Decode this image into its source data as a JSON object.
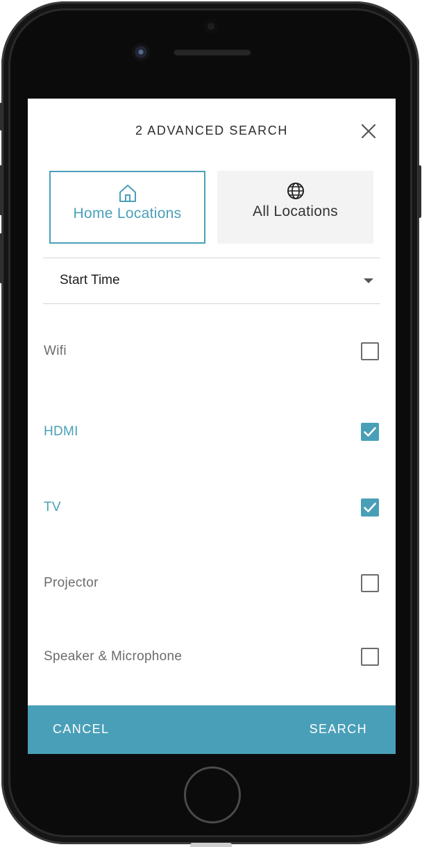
{
  "header": {
    "title": "2 ADVANCED SEARCH",
    "close_icon": "close-icon"
  },
  "location_toggle": {
    "home": {
      "label": "Home Locations",
      "icon": "home-icon",
      "selected": true
    },
    "all": {
      "label": "All Locations",
      "icon": "globe-icon",
      "selected": false
    }
  },
  "sort": {
    "selected": "Start Time",
    "icon": "caret-down-icon"
  },
  "options": [
    {
      "label": "Wifi",
      "checked": false
    },
    {
      "label": "HDMI",
      "checked": true
    },
    {
      "label": "TV",
      "checked": true
    },
    {
      "label": "Projector",
      "checked": false
    },
    {
      "label": "Speaker & Microphone",
      "checked": false
    }
  ],
  "footer": {
    "cancel_label": "CANCEL",
    "search_label": "SEARCH"
  },
  "colors": {
    "accent": "#4a9fb8",
    "text_dark": "#2c2c2c",
    "text_muted": "#6b6b6b",
    "inactive_bg": "#f3f3f3"
  }
}
